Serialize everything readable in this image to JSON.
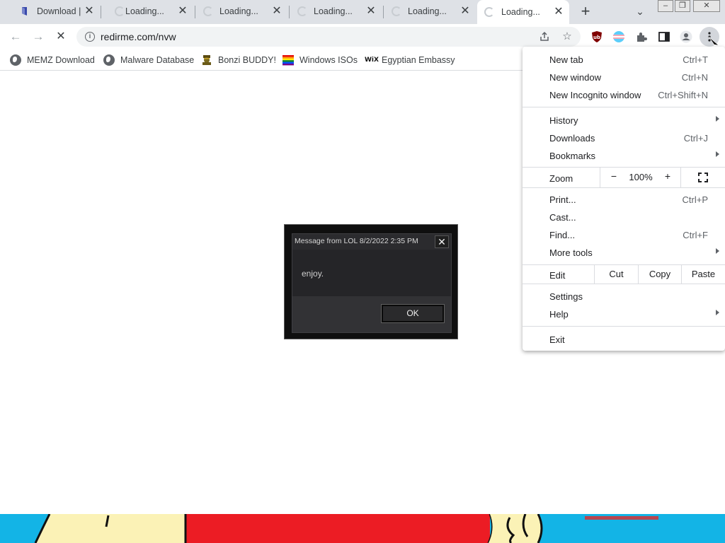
{
  "browser": {
    "tabs": [
      {
        "title": "Download | f",
        "state": "favicon"
      },
      {
        "title": "Loading...",
        "state": "loading"
      },
      {
        "title": "Loading...",
        "state": "loading"
      },
      {
        "title": "Loading...",
        "state": "loading"
      },
      {
        "title": "Loading...",
        "state": "loading"
      },
      {
        "title": "Loading...",
        "state": "loading-active"
      }
    ],
    "window_controls": {
      "minimize": "‒",
      "restore": "❐",
      "close": "✕"
    },
    "new_tab_glyph": "+",
    "tab_search_glyph": "⌄",
    "url": "redirme.com/nvw",
    "bookmarks": [
      {
        "label": "MEMZ Download",
        "icon": "globe-icon"
      },
      {
        "label": "Malware Database",
        "icon": "globe-icon"
      },
      {
        "label": "Bonzi BUDDY!",
        "icon": "bonzi-icon"
      },
      {
        "label": "Windows ISOs",
        "icon": "rainbow-flag-icon"
      },
      {
        "label": "Egyptian Embassy",
        "icon": "wix-icon"
      }
    ],
    "wix_text": "WiX"
  },
  "dialog": {
    "title": "Message from LOL 8/2/2022 2:35 PM",
    "close_glyph": "✕",
    "message": "enjoy.",
    "ok_label": "OK"
  },
  "menu": {
    "group1": [
      {
        "label": "New tab",
        "shortcut": "Ctrl+T"
      },
      {
        "label": "New window",
        "shortcut": "Ctrl+N"
      },
      {
        "label": "New Incognito window",
        "shortcut": "Ctrl+Shift+N"
      }
    ],
    "group2": [
      {
        "label": "History",
        "shortcut": "",
        "submenu": true
      },
      {
        "label": "Downloads",
        "shortcut": "Ctrl+J"
      },
      {
        "label": "Bookmarks",
        "shortcut": "",
        "submenu": true
      }
    ],
    "zoom": {
      "label": "Zoom",
      "minus": "−",
      "value": "100%",
      "plus": "+"
    },
    "group3": [
      {
        "label": "Print...",
        "shortcut": "Ctrl+P"
      },
      {
        "label": "Cast...",
        "shortcut": ""
      },
      {
        "label": "Find...",
        "shortcut": "Ctrl+F"
      },
      {
        "label": "More tools",
        "shortcut": "",
        "submenu": true
      }
    ],
    "edit": {
      "label": "Edit",
      "cut": "Cut",
      "copy": "Copy",
      "paste": "Paste"
    },
    "group4": [
      {
        "label": "Settings",
        "shortcut": ""
      },
      {
        "label": "Help",
        "shortcut": "",
        "submenu": true
      }
    ],
    "exit_label": "Exit"
  },
  "colors": {
    "tabstrip": "#dee1e6",
    "omnibox": "#f1f3f4",
    "dialog_bg": "#2b2b2e",
    "art_cyan": "#13b4e6",
    "art_yellow": "#fbf2b6",
    "art_red": "#ec1c24"
  }
}
